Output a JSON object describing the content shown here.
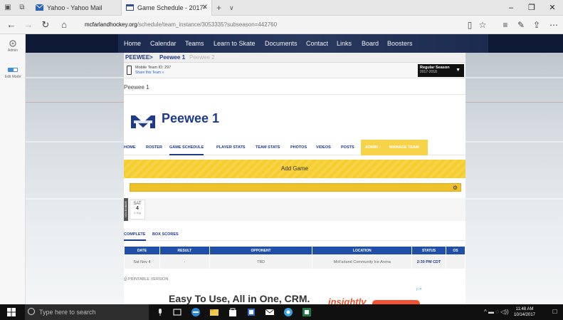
{
  "browser": {
    "tabs": [
      {
        "title": "Yahoo - Yahoo Mail",
        "active": false
      },
      {
        "title": "Game Schedule - 2017-",
        "active": true
      }
    ],
    "new_tab": "+",
    "tab_list": "∨",
    "url_host": "mcfarlandhockey.org",
    "url_path": "/schedule/team_instance/3053335?subseason=442760",
    "window": {
      "minimize": "–",
      "maximize": "❐",
      "close": "✕"
    }
  },
  "rail": {
    "items": [
      {
        "label": "Admin"
      },
      {
        "label": "Edit Mode"
      }
    ]
  },
  "site_nav": {
    "links": [
      "Home",
      "Calendar",
      "Teams",
      "Learn to Skate",
      "Documents",
      "Contact",
      "Links",
      "Board",
      "Boosters"
    ]
  },
  "team_bar": {
    "crumbs": [
      "PEEWEE",
      "Peewee 1",
      "Peewee 2"
    ],
    "sep": ">"
  },
  "mobile": {
    "id_text": "Mobile Team ID: 297",
    "share_text": "Share this Team »"
  },
  "season": {
    "line1": "Regular Season",
    "line2": "2017-2018"
  },
  "page_label": "Peewee 1",
  "team_title": "Peewee 1",
  "section_tabs": [
    "HOME",
    "ROSTER",
    "GAME SCHEDULE",
    "PLAYER STATS",
    "TEAM STATS",
    "PHOTOS",
    "VIDEOS",
    "POSTS"
  ],
  "admin_tabs": [
    "ADMIN ↓",
    "MANAGE TEAM"
  ],
  "add_game": "Add Game",
  "date_card": {
    "month": "NOVEMBER",
    "dow": "SAT",
    "day": "4",
    "time": "2:30p"
  },
  "sub_tabs": [
    "COMPLETE",
    "BOX SCORES"
  ],
  "schedule": {
    "headers": [
      "DATE",
      "RESULT",
      "OPPONENT",
      "LOCATION",
      "STATUS",
      "OS"
    ],
    "rows": [
      {
        "date": "Sat Nov 4",
        "result": "-",
        "opponent": "TBD",
        "location": "McFarland Community Ice Arena",
        "status": "2:30 PM CDT"
      }
    ]
  },
  "printable": "PRINTABLE VERSION",
  "ad": {
    "text": "Easy To Use, All in One, CRM.",
    "brand": "insightly"
  },
  "taskbar": {
    "search_placeholder": "Type here to search",
    "time": "11:48 AM",
    "date": "10/14/2017"
  },
  "colors": {
    "brand_blue": "#1e3a8a",
    "nav_dark": "#0e1a35",
    "accent_yellow": "#f5cd2e",
    "table_header": "#1f4fa8"
  }
}
